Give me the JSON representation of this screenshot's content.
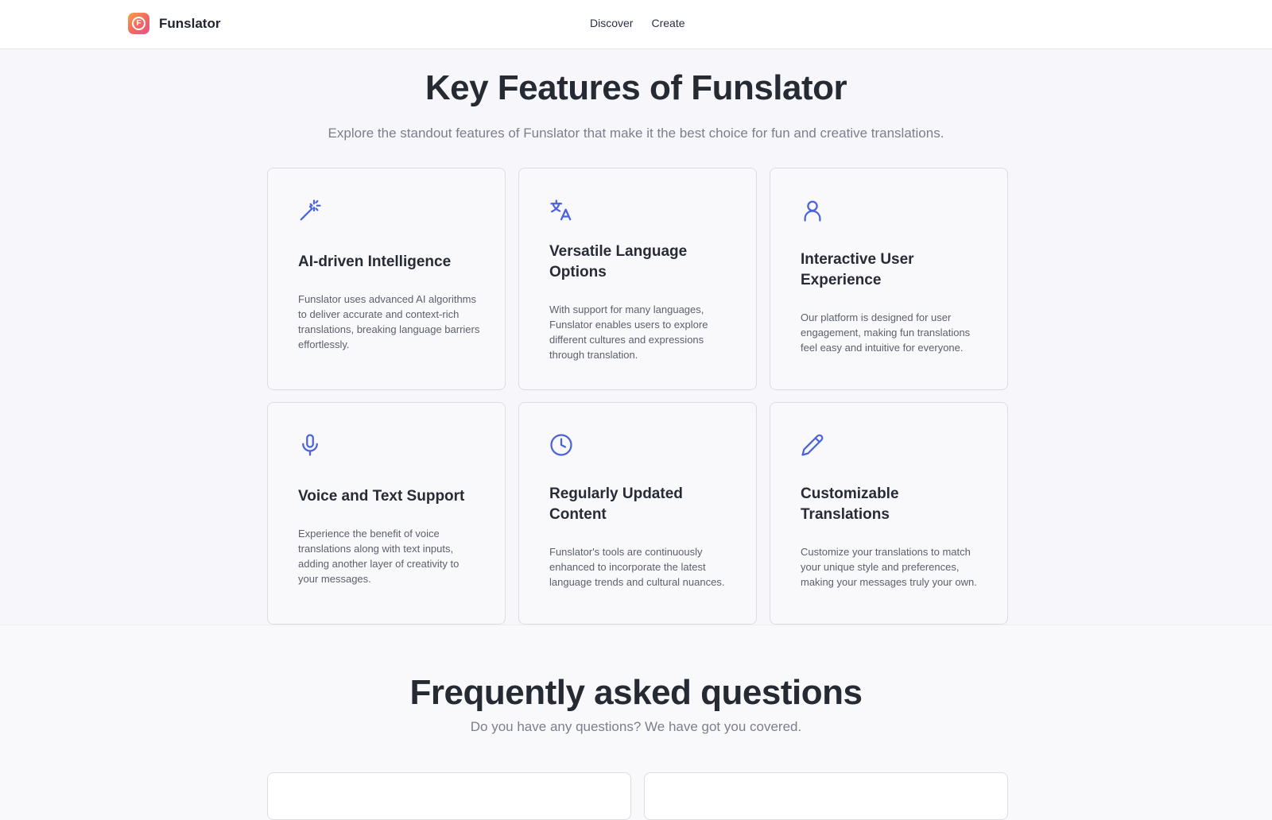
{
  "header": {
    "brand_name": "Funslator",
    "logo_letter": "F",
    "nav": [
      {
        "label": "Discover"
      },
      {
        "label": "Create"
      }
    ]
  },
  "features": {
    "title": "Key Features of Funslator",
    "subtitle": "Explore the standout features of Funslator that make it the best choice for fun and creative translations.",
    "cards": [
      {
        "icon": "magic-wand-icon",
        "title": "AI-driven Intelligence",
        "description": "Funslator uses advanced AI algorithms to deliver accurate and context-rich translations, breaking language barriers effortlessly."
      },
      {
        "icon": "translate-icon",
        "title": "Versatile Language Options",
        "description": "With support for many languages, Funslator enables users to explore different cultures and expressions through translation."
      },
      {
        "icon": "user-icon",
        "title": "Interactive User Experience",
        "description": "Our platform is designed for user engagement, making fun translations feel easy and intuitive for everyone."
      },
      {
        "icon": "microphone-icon",
        "title": "Voice and Text Support",
        "description": "Experience the benefit of voice translations along with text inputs, adding another layer of creativity to your messages."
      },
      {
        "icon": "clock-icon",
        "title": "Regularly Updated Content",
        "description": "Funslator's tools are continuously enhanced to incorporate the latest language trends and cultural nuances."
      },
      {
        "icon": "pencil-icon",
        "title": "Customizable Translations",
        "description": "Customize your translations to match your unique style and preferences, making your messages truly your own."
      }
    ]
  },
  "faq": {
    "title": "Frequently asked questions",
    "subtitle": "Do you have any questions? We have got you covered."
  },
  "colors": {
    "accent": "#4a63db",
    "background": "#f7f7fb",
    "border": "#dcdde3"
  }
}
